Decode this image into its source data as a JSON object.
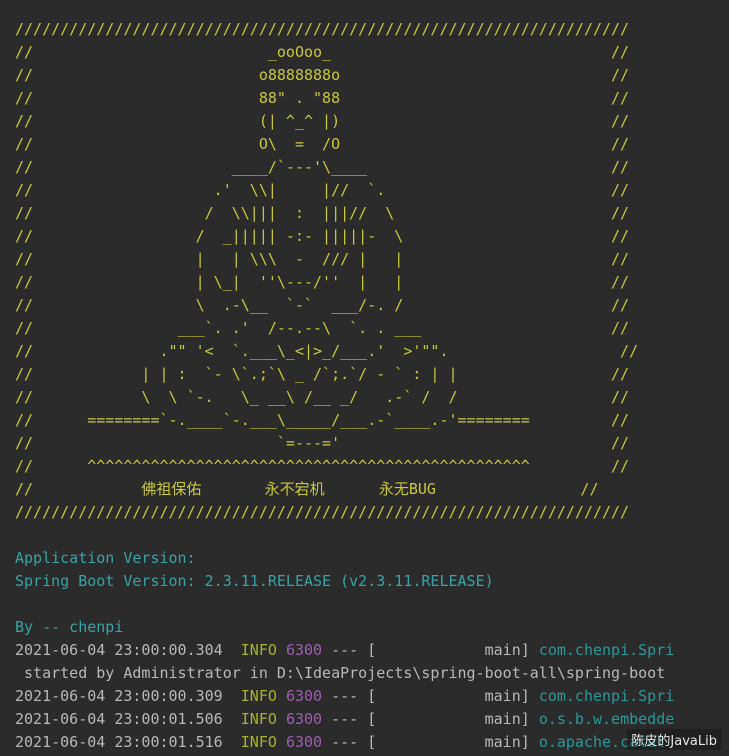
{
  "banner": [
    "////////////////////////////////////////////////////////////////////",
    "//                          _ooOoo_                               //",
    "//                         o8888888o                              //",
    "//                         88\" . \"88                              //",
    "//                         (| ^_^ |)                              //",
    "//                         O\\  =  /O                              //",
    "//                      ____/`---'\\____                           //",
    "//                    .'  \\\\|     |//  `.                         //",
    "//                   /  \\\\|||  :  |||//  \\                        //",
    "//                  /  _||||| -:- |||||-  \\                       //",
    "//                  |   | \\\\\\  -  /// |   |                       //",
    "//                  | \\_|  ''\\---/''  |   |                       //",
    "//                  \\  .-\\__  `-`  ___/-. /                       //",
    "//                ___`. .'  /--.--\\  `. . ___                     //",
    "//              .\"\" '<  `.___\\_<|>_/___.'  >'\"\".                   //",
    "//            | | :  `- \\`.;`\\ _ /`;.`/ - ` : | |                 //",
    "//            \\  \\ `-.   \\_ __\\ /__ _/   .-` /  /                 //",
    "//      ========`-.____`-.___\\_____/___.-`____.-'========         //",
    "//                           `=---='                              //",
    "//      ^^^^^^^^^^^^^^^^^^^^^^^^^^^^^^^^^^^^^^^^^^^^^^^^^         //",
    "//            佛祖保佑       永不宕机      永无BUG                //",
    "////////////////////////////////////////////////////////////////////"
  ],
  "app": {
    "version_line": "Application Version: ",
    "boot_line": "Spring Boot Version: 2.3.11.RELEASE (v2.3.11.RELEASE)"
  },
  "by_line": "By -- chenpi",
  "logs": [
    {
      "time": "2021-06-04 23:00:00.304",
      "level": "INFO",
      "pid": "6300",
      "sep": " --- [",
      "thread": "           main]",
      "logger": "com.chenpi.Spri"
    },
    {
      "continuation": " started by Administrator in D:\\IdeaProjects\\spring-boot-all\\spring-boot"
    },
    {
      "time": "2021-06-04 23:00:00.309",
      "level": "INFO",
      "pid": "6300",
      "sep": " --- [",
      "thread": "           main]",
      "logger": "com.chenpi.Spri"
    },
    {
      "time": "2021-06-04 23:00:01.506",
      "level": "INFO",
      "pid": "6300",
      "sep": " --- [",
      "thread": "           main]",
      "logger": "o.s.b.w.embedde"
    },
    {
      "time": "2021-06-04 23:00:01.516",
      "level": "INFO",
      "pid": "6300",
      "sep": " --- [",
      "thread": "           main]",
      "logger": "o.apache.catal"
    }
  ],
  "watermark": "陈皮的JavaLib",
  "colors": {
    "background": "#2b2b2b",
    "banner": "#c8c83c",
    "info": "#a8b22a",
    "pid": "#9a5fb0",
    "logger": "#299999",
    "app_info": "#3aa3a3"
  }
}
